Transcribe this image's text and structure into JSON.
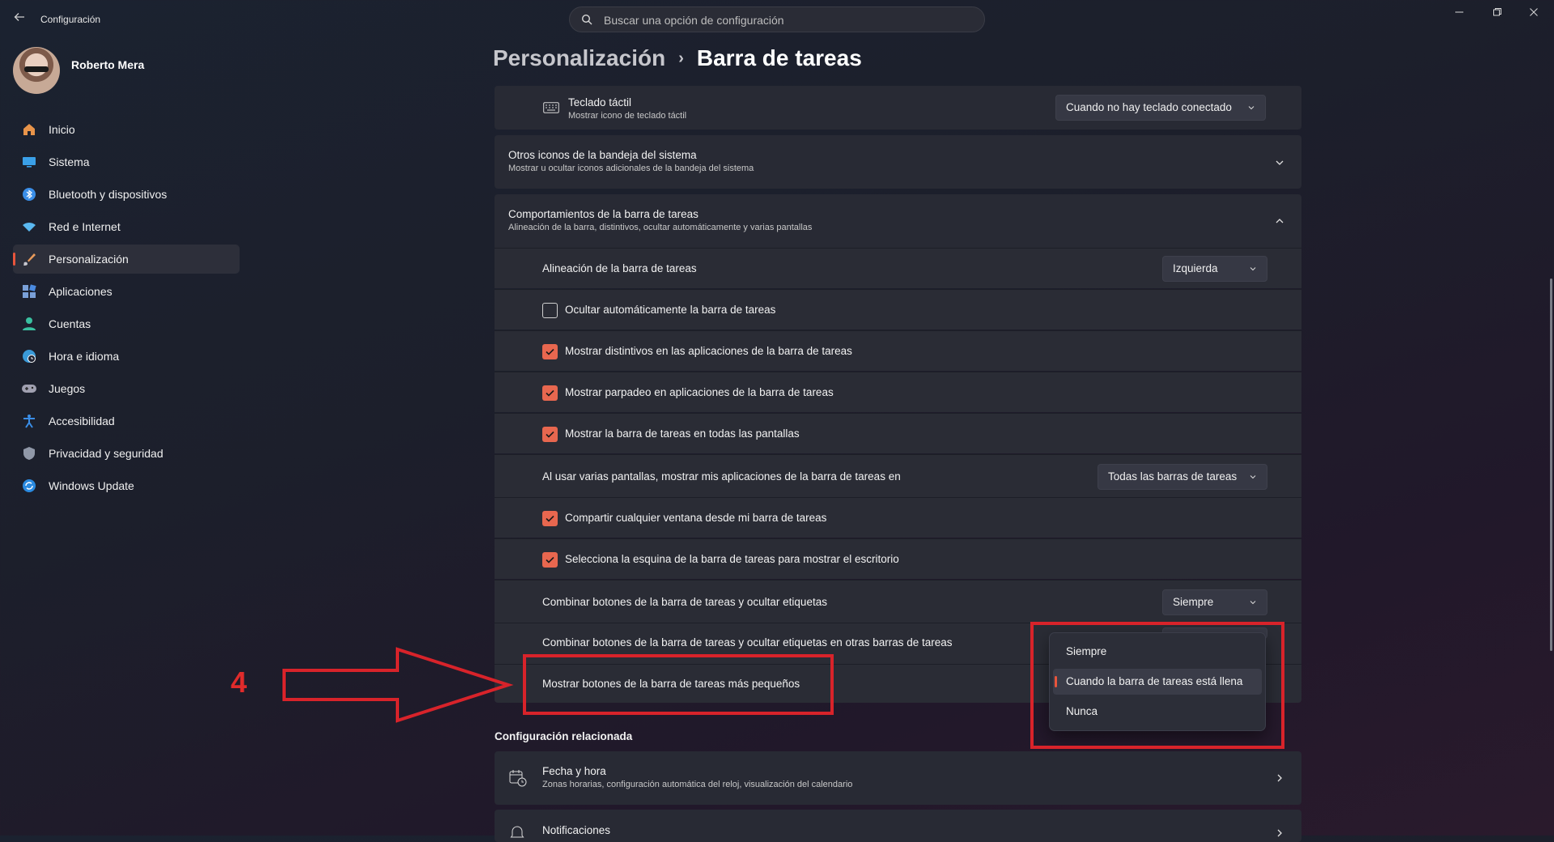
{
  "window": {
    "app_title": "Configuración",
    "search_placeholder": "Buscar una opción de configuración",
    "controls": [
      "minimize",
      "maximize",
      "close"
    ]
  },
  "profile": {
    "name": "Roberto Mera"
  },
  "sidebar": {
    "items": [
      {
        "label": "Inicio",
        "icon": "home-icon",
        "color": "#e8944a"
      },
      {
        "label": "Sistema",
        "icon": "monitor-icon",
        "color": "#3aa0e8"
      },
      {
        "label": "Bluetooth y dispositivos",
        "icon": "bluetooth-icon",
        "color": "#3a8ee8"
      },
      {
        "label": "Red e Internet",
        "icon": "wifi-icon",
        "color": "#5ab8f0"
      },
      {
        "label": "Personalización",
        "icon": "brush-icon",
        "color": "#e89a5a",
        "active": true
      },
      {
        "label": "Aplicaciones",
        "icon": "apps-icon",
        "color": "#7aa0d8"
      },
      {
        "label": "Cuentas",
        "icon": "person-icon",
        "color": "#3ac0a0"
      },
      {
        "label": "Hora e idioma",
        "icon": "globe-clock-icon",
        "color": "#3a9ad8"
      },
      {
        "label": "Juegos",
        "icon": "gamepad-icon",
        "color": "#a0a0b0"
      },
      {
        "label": "Accesibilidad",
        "icon": "accessibility-icon",
        "color": "#3a8ee8"
      },
      {
        "label": "Privacidad y seguridad",
        "icon": "shield-icon",
        "color": "#9098a8"
      },
      {
        "label": "Windows Update",
        "icon": "update-icon",
        "color": "#2a8ae0"
      }
    ]
  },
  "breadcrumb": {
    "parent": "Personalización",
    "separator": "›",
    "current": "Barra de tareas"
  },
  "touch_keyboard": {
    "title": "Teclado táctil",
    "subtitle": "Mostrar icono de teclado táctil",
    "value": "Cuando no hay teclado conectado"
  },
  "other_icons": {
    "title": "Otros iconos de la bandeja del sistema",
    "subtitle": "Mostrar u ocultar iconos adicionales de la bandeja del sistema"
  },
  "behaviors": {
    "title": "Comportamientos de la barra de tareas",
    "subtitle": "Alineación de la barra, distintivos, ocultar automáticamente y varias pantallas",
    "rows": [
      {
        "type": "dropdown",
        "label": "Alineación de la barra de tareas",
        "value": "Izquierda"
      },
      {
        "type": "checkbox",
        "label": "Ocultar automáticamente la barra de tareas",
        "checked": false
      },
      {
        "type": "checkbox",
        "label": "Mostrar distintivos en las aplicaciones de la barra de tareas",
        "checked": true
      },
      {
        "type": "checkbox",
        "label": "Mostrar parpadeo en aplicaciones de la barra de tareas",
        "checked": true
      },
      {
        "type": "checkbox",
        "label": "Mostrar la barra de tareas en todas las pantallas",
        "checked": true
      },
      {
        "type": "dropdown",
        "label": "Al usar varias pantallas, mostrar mis aplicaciones de la barra de tareas en",
        "value": "Todas las barras de tareas"
      },
      {
        "type": "checkbox",
        "label": "Compartir cualquier ventana desde mi barra de tareas",
        "checked": true
      },
      {
        "type": "checkbox",
        "label": "Selecciona la esquina de la barra de tareas para mostrar el escritorio",
        "checked": true
      },
      {
        "type": "dropdown",
        "label": "Combinar botones de la barra de tareas y ocultar etiquetas",
        "value": "Siempre"
      },
      {
        "type": "dropdown",
        "label": "Combinar botones de la barra de tareas y ocultar etiquetas en otras barras de tareas",
        "value": ""
      },
      {
        "type": "dropdown-open",
        "label": "Mostrar botones de la barra de tareas más pequeños"
      }
    ]
  },
  "dropdown_popup": {
    "options": [
      "Siempre",
      "Cuando la barra de tareas está llena",
      "Nunca"
    ],
    "selected": "Cuando la barra de tareas está llena"
  },
  "related": {
    "heading": "Configuración relacionada",
    "items": [
      {
        "title": "Fecha y hora",
        "subtitle": "Zonas horarias, configuración automática del reloj, visualización del calendario",
        "icon": "calendar-clock-icon"
      },
      {
        "title": "Notificaciones",
        "icon": "bell-icon"
      }
    ]
  },
  "annotation": {
    "number": "4",
    "color": "#d8232a"
  },
  "accent": "#e8674f"
}
